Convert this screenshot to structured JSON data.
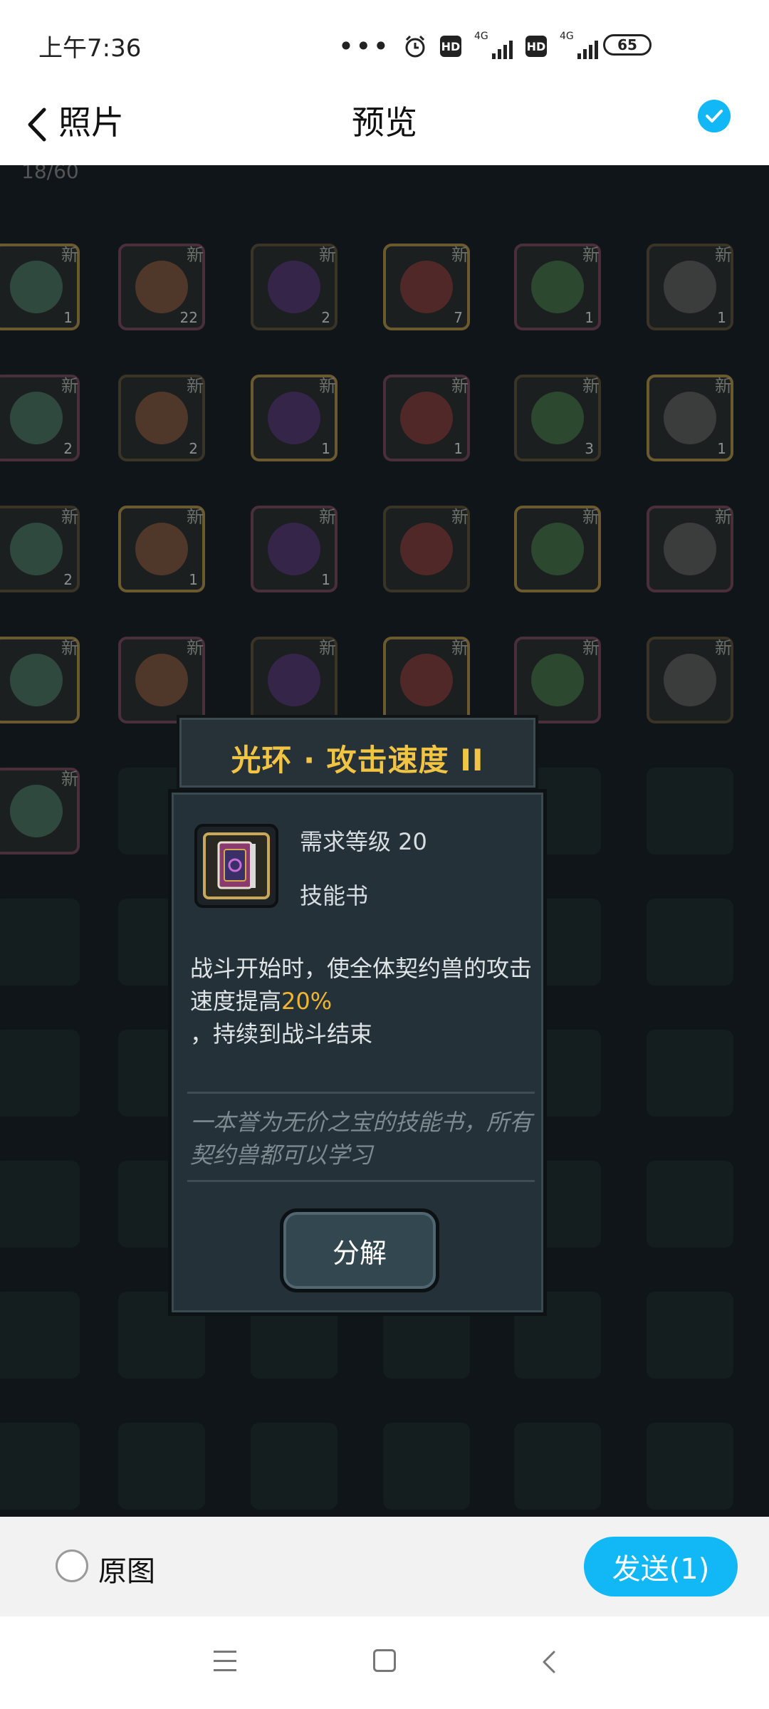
{
  "status_bar": {
    "time": "上午7:36",
    "dots": "•••",
    "hd_label": "HD",
    "signal_label": "4G",
    "battery": "65"
  },
  "nav": {
    "back_label": "照片",
    "title": "预览"
  },
  "game": {
    "top_counter": "18/60",
    "grid_new_label": "新",
    "counts": [
      "1",
      "22",
      "2",
      "7",
      "1",
      "1",
      "2",
      "2",
      "1",
      "1",
      "3",
      "1",
      "2",
      "1",
      "1"
    ]
  },
  "dialog": {
    "title": "光环 · 攻击速度 II",
    "requirement": "需求等级 20",
    "item_type": "技能书",
    "description_prefix": "战斗开始时，使全体契约兽的攻击速度提高",
    "description_highlight": "20%",
    "description_suffix": "，持续到战斗结束",
    "flavor_text": "一本誉为无价之宝的技能书，所有契约兽都可以学习",
    "decompose_button": "分解"
  },
  "bottom_bar": {
    "original_label": "原图",
    "send_button": "发送(1)"
  },
  "colors": {
    "accent": "#12b7f5",
    "title_gold": "#f2c443",
    "highlight": "#f2b530"
  }
}
